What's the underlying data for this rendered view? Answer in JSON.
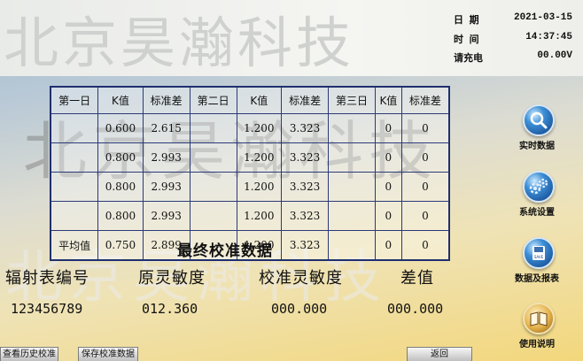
{
  "header": {
    "watermark": "北京昊瀚科技",
    "status": [
      {
        "label": "日 期",
        "value": "2021-03-15"
      },
      {
        "label": "时 间",
        "value": "14:37:45"
      },
      {
        "label": "请充电",
        "value": "00.00V"
      }
    ]
  },
  "watermark_text": "北京昊瀚科技",
  "table": {
    "headers": [
      "第一日",
      "K值",
      "标准差",
      "第二日",
      "K值",
      "标准差",
      "第三日",
      "K值",
      "标准差"
    ],
    "rows": [
      [
        "",
        "0.600",
        "2.615",
        "",
        "1.200",
        "3.323",
        "",
        "0",
        "0"
      ],
      [
        "",
        "0.800",
        "2.993",
        "",
        "1.200",
        "3.323",
        "",
        "0",
        "0"
      ],
      [
        "",
        "0.800",
        "2.993",
        "",
        "1.200",
        "3.323",
        "",
        "0",
        "0"
      ],
      [
        "",
        "0.800",
        "2.993",
        "",
        "1.200",
        "3.323",
        "",
        "0",
        "0"
      ],
      [
        "平均值",
        "0.750",
        "2.899",
        "",
        "1.200",
        "3.323",
        "",
        "0",
        "0"
      ]
    ]
  },
  "final": {
    "title": "最终校准数据",
    "headers": [
      "辐射表编号",
      "原灵敏度",
      "校准灵敏度",
      "差值"
    ],
    "values": [
      "123456789",
      "012.360",
      "000.000",
      "000.000"
    ]
  },
  "sidebar": {
    "buttons": [
      {
        "label": "实时数据",
        "icon": "magnifier-icon"
      },
      {
        "label": "系统设置",
        "icon": "gears-icon"
      },
      {
        "label": "数据及报表",
        "icon": "save-icon"
      },
      {
        "label": "使用说明",
        "icon": "book-icon"
      }
    ],
    "save_icon_text": "SAVE"
  },
  "bottom": {
    "history": "查看历史校准",
    "save": "保存校准数据",
    "back": "返回"
  }
}
